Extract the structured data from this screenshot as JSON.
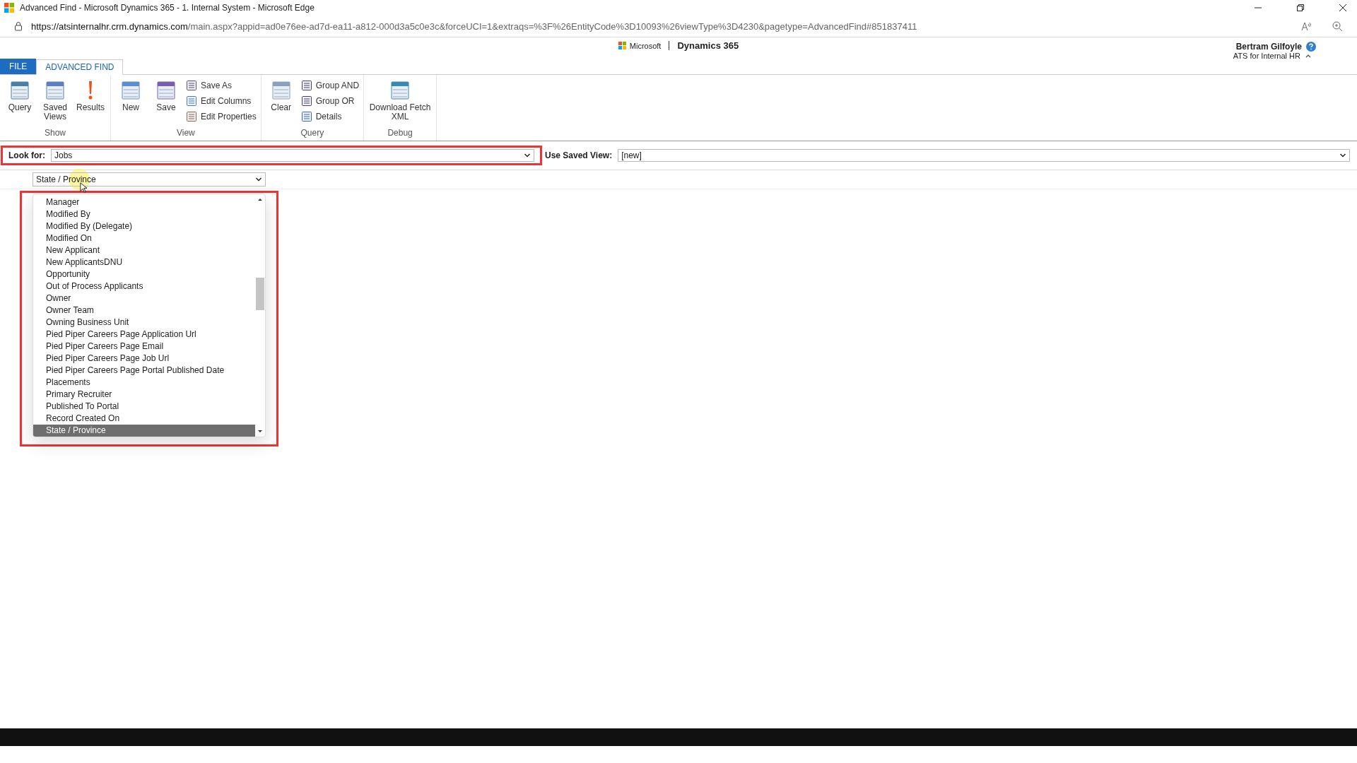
{
  "window": {
    "title": "Advanced Find - Microsoft Dynamics 365 - 1. Internal System - Microsoft Edge"
  },
  "browser": {
    "url_host": "https://atsinternalhr.crm.dynamics.com",
    "url_rest": "/main.aspx?appid=ad0e76ee-ad7d-ea11-a812-000d3a5c0e3c&forceUCI=1&extraqs=%3F%26EntityCode%3D10093%26viewType%3D4230&pagetype=AdvancedFind#851837411"
  },
  "header": {
    "brand": "Microsoft",
    "product": "Dynamics 365",
    "user_name": "Bertram Gilfoyle",
    "org": "ATS for Internal HR"
  },
  "ribbon": {
    "tabs": [
      {
        "label": "FILE",
        "kind": "file",
        "selected": false
      },
      {
        "label": "ADVANCED FIND",
        "kind": "tab",
        "selected": true
      }
    ],
    "groups": [
      {
        "label": "Show",
        "items": [
          {
            "label": "Query",
            "kind": "large"
          },
          {
            "label": "Saved Views",
            "kind": "large"
          },
          {
            "label": "Results",
            "kind": "large"
          }
        ]
      },
      {
        "label": "View",
        "items": [
          {
            "label": "New",
            "kind": "large"
          },
          {
            "label": "Save",
            "kind": "large"
          },
          {
            "label": "Save As",
            "kind": "small"
          },
          {
            "label": "Edit Columns",
            "kind": "small"
          },
          {
            "label": "Edit Properties",
            "kind": "small"
          }
        ]
      },
      {
        "label": "Query",
        "items": [
          {
            "label": "Clear",
            "kind": "large"
          },
          {
            "label": "Group AND",
            "kind": "small"
          },
          {
            "label": "Group OR",
            "kind": "small"
          },
          {
            "label": "Details",
            "kind": "small"
          }
        ]
      },
      {
        "label": "Debug",
        "items": [
          {
            "label": "Download Fetch XML",
            "kind": "large"
          }
        ]
      }
    ]
  },
  "filter": {
    "look_for_label": "Look for:",
    "look_for_value": "Jobs",
    "saved_view_label": "Use Saved View:",
    "saved_view_value": "[new]"
  },
  "condition": {
    "field_value": "State / Province"
  },
  "field_list": [
    {
      "label": "Manager",
      "selected": false
    },
    {
      "label": "Modified By",
      "selected": false
    },
    {
      "label": "Modified By (Delegate)",
      "selected": false
    },
    {
      "label": "Modified On",
      "selected": false
    },
    {
      "label": "New Applicant",
      "selected": false
    },
    {
      "label": "New ApplicantsDNU",
      "selected": false
    },
    {
      "label": "Opportunity",
      "selected": false
    },
    {
      "label": "Out of Process Applicants",
      "selected": false
    },
    {
      "label": "Owner",
      "selected": false
    },
    {
      "label": "Owner Team",
      "selected": false
    },
    {
      "label": "Owning Business Unit",
      "selected": false
    },
    {
      "label": "Pied Piper Careers Page Application Url",
      "selected": false
    },
    {
      "label": "Pied Piper Careers Page Email",
      "selected": false
    },
    {
      "label": "Pied Piper Careers Page Job Url",
      "selected": false
    },
    {
      "label": "Pied Piper Careers Page Portal Published Date",
      "selected": false
    },
    {
      "label": "Placements",
      "selected": false
    },
    {
      "label": "Primary Recruiter",
      "selected": false
    },
    {
      "label": "Published To Portal",
      "selected": false
    },
    {
      "label": "Record Created On",
      "selected": false
    },
    {
      "label": "State / Province",
      "selected": true
    }
  ]
}
